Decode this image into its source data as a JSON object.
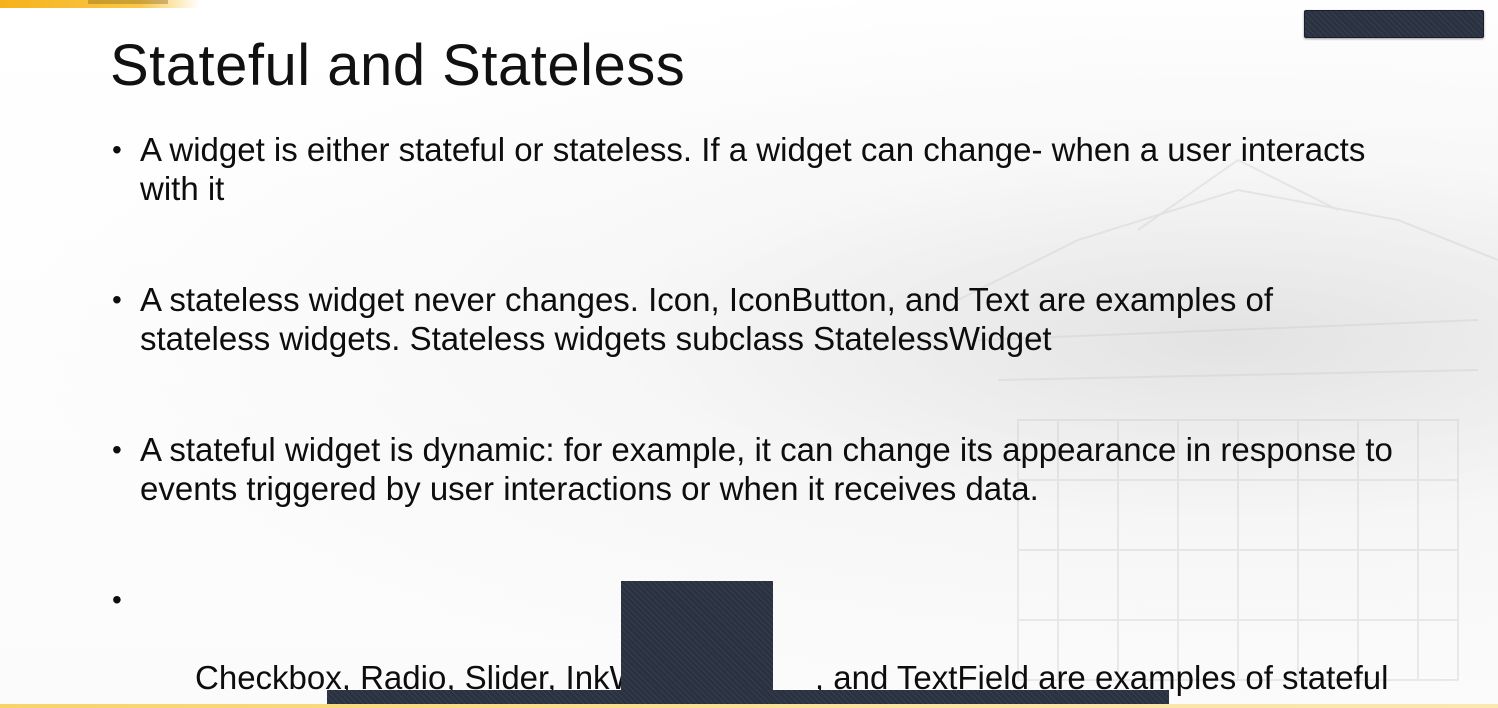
{
  "slide": {
    "title": "Stateful and Stateless",
    "bullet_glyph": "•",
    "bullets": [
      {
        "text": "A widget is either stateful or stateless.  If a widget can change- when a user interacts with it"
      },
      {
        "text": "A stateless widget never changes.  Icon, IconButton, and Text are examples of stateless widgets.  Stateless widgets subclass StatelessWidget"
      },
      {
        "text": "A stateful widget is dynamic: for example, it can change its appearance in response to events triggered by user interactions or when it receives data."
      },
      {
        "text": "Checkbox, Radio, Slider, InkW                   , and TextField are examples of stateful widgets.  Stateful wid                 class StatefulWidget."
      }
    ]
  },
  "colors": {
    "accent": "#f6b21a",
    "redaction": "#2a3140",
    "text": "#0d0d0d"
  }
}
